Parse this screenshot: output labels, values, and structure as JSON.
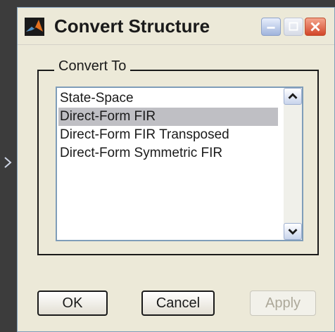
{
  "window": {
    "title": "Convert Structure"
  },
  "group": {
    "label": "Convert To"
  },
  "list": {
    "items": [
      {
        "label": "State-Space",
        "selected": false
      },
      {
        "label": "Direct-Form FIR",
        "selected": true
      },
      {
        "label": "Direct-Form FIR Transposed",
        "selected": false
      },
      {
        "label": "Direct-Form Symmetric FIR",
        "selected": false
      }
    ]
  },
  "buttons": {
    "ok": "OK",
    "cancel": "Cancel",
    "apply": "Apply"
  },
  "icons": {
    "app": "matlab-logo-icon",
    "minimize": "minimize-icon",
    "maximize": "maximize-icon",
    "close": "close-icon",
    "scroll_up": "chevron-up-icon",
    "scroll_down": "chevron-down-icon",
    "side": "chevron-right-icon"
  },
  "colors": {
    "selection": "#bfbfc4",
    "dialog_bg": "#ece9d8",
    "close_button": "#d2462a"
  }
}
